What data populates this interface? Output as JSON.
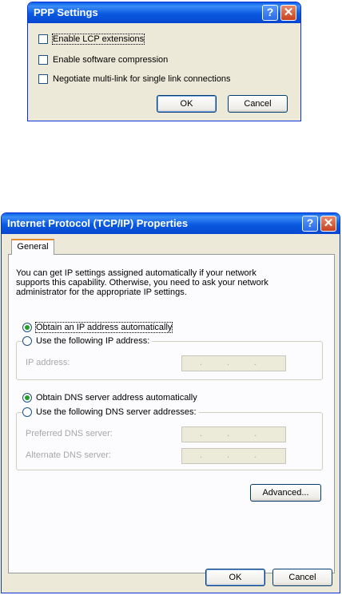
{
  "ppp": {
    "title": "PPP Settings",
    "checkboxes": [
      {
        "label": "Enable LCP extensions",
        "checked": false
      },
      {
        "label": "Enable software compression",
        "checked": false
      },
      {
        "label": "Negotiate multi-link for single link connections",
        "checked": false
      }
    ],
    "ok_label": "OK",
    "cancel_label": "Cancel"
  },
  "tcpip": {
    "title": "Internet Protocol (TCP/IP) Properties",
    "tab": "General",
    "description": "You can get IP settings assigned automatically if your network supports this capability. Otherwise, you need to ask your network administrator for the appropriate IP settings.",
    "ip_auto_label": "Obtain an IP address automatically",
    "ip_manual_label": "Use the following IP address:",
    "ip_address_label": "IP address:",
    "dns_auto_label": "Obtain DNS server address automatically",
    "dns_manual_label": "Use the following DNS server addresses:",
    "preferred_dns_label": "Preferred DNS server:",
    "alternate_dns_label": "Alternate DNS server:",
    "ip_placeholder": ". . .",
    "advanced_label": "Advanced...",
    "ok_label": "OK",
    "cancel_label": "Cancel",
    "ip_auto_selected": true,
    "dns_auto_selected": true
  },
  "icons": {
    "help": "help-icon",
    "close": "close-icon"
  },
  "colors": {
    "titlebar": "#0a5ae0",
    "dialog_bg": "#ece9d8",
    "tab_accent": "#e68b2c",
    "radio_dot": "#21a121"
  }
}
